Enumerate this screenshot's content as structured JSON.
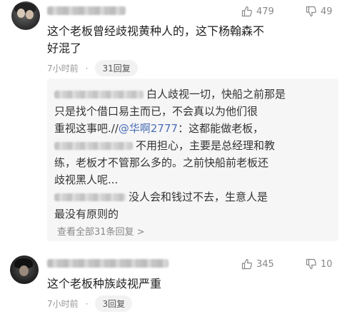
{
  "comments": [
    {
      "likes": "479",
      "dislikes": "49",
      "text_line1": "这个老板曾经歧视黄种人的，这下杨翰森不",
      "text_line2": "好混了",
      "time": "7小时前",
      "reply_count": "31回复",
      "replies": [
        {
          "line1": "白人歧视一切，快船之前那是",
          "line2": "只是找个借口易主而已，不会真以为他们很",
          "line3_pre": "重视这事吧.//",
          "line3_mention": "@华啊2777",
          "line3_post": "：这都能做老板，"
        },
        {
          "line1": "不用担心，主要是总经理和教",
          "line2": "练，老板才不管那么多的。之前快船前老板还",
          "line3": "歧视黑人呢..."
        },
        {
          "line1": "没人会和钱过不去，生意人是",
          "line2": "最没有原则的"
        }
      ],
      "view_all": "查看全部31条回复 >"
    },
    {
      "likes": "345",
      "dislikes": "10",
      "text_line1": "这个老板种族歧视严重",
      "time": "7小时前",
      "reply_count": "3回复"
    }
  ]
}
